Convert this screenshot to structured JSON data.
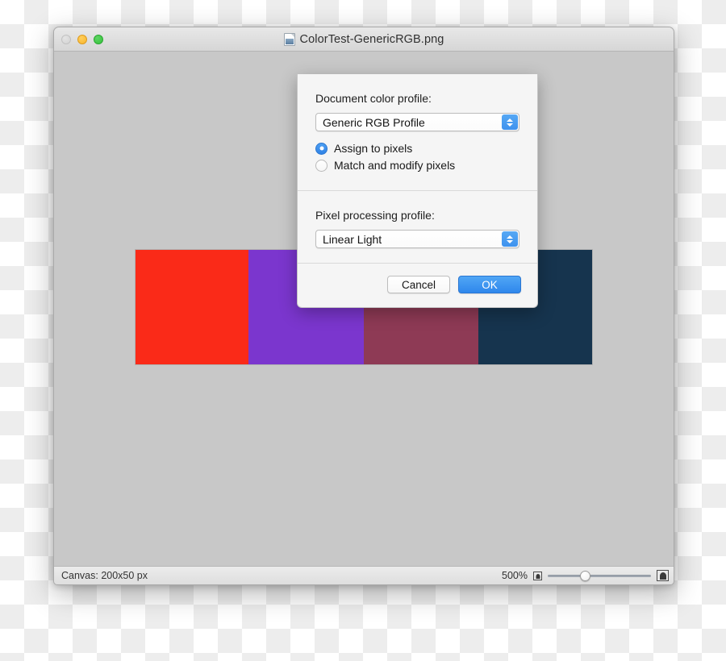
{
  "window": {
    "title": "ColorTest-GenericRGB.png",
    "doc_icon": "image-document-icon",
    "traffic_lights": [
      {
        "name": "close",
        "label": "Close",
        "color": "#d2d2d2",
        "enabled": false
      },
      {
        "name": "minimize",
        "label": "Minimize",
        "color": "#f8b62b",
        "enabled": true
      },
      {
        "name": "zoom",
        "label": "Zoom",
        "color": "#35c33c",
        "enabled": true
      }
    ]
  },
  "canvas": {
    "background": "#c8c8c8",
    "swatches": [
      {
        "name": "red",
        "color": "#fa2a18",
        "width_pct": 24.7
      },
      {
        "name": "purple",
        "color": "#7b36ce",
        "width_pct": 25.3
      },
      {
        "name": "mauve",
        "color": "#8e3a55",
        "width_pct": 25.1
      },
      {
        "name": "navy",
        "color": "#16344e",
        "width_pct": 24.9
      }
    ]
  },
  "statusbar": {
    "canvas_size": "Canvas: 200x50 px",
    "zoom_level": "500%",
    "zoom_out_icon": "small-picture-icon",
    "zoom_in_icon": "large-picture-icon",
    "slider_position_pct": 31
  },
  "sheet": {
    "document_profile": {
      "label": "Document color profile:",
      "value": "Generic RGB Profile",
      "options": [
        "Generic RGB Profile"
      ]
    },
    "pixel_action": {
      "options": [
        {
          "label": "Assign to pixels",
          "selected": true
        },
        {
          "label": "Match and modify pixels",
          "selected": false
        }
      ]
    },
    "pixel_profile": {
      "label": "Pixel processing profile:",
      "value": "Linear Light",
      "options": [
        "Linear Light"
      ]
    },
    "buttons": {
      "cancel": "Cancel",
      "ok": "OK"
    },
    "accent_color": "#2f87ec"
  }
}
